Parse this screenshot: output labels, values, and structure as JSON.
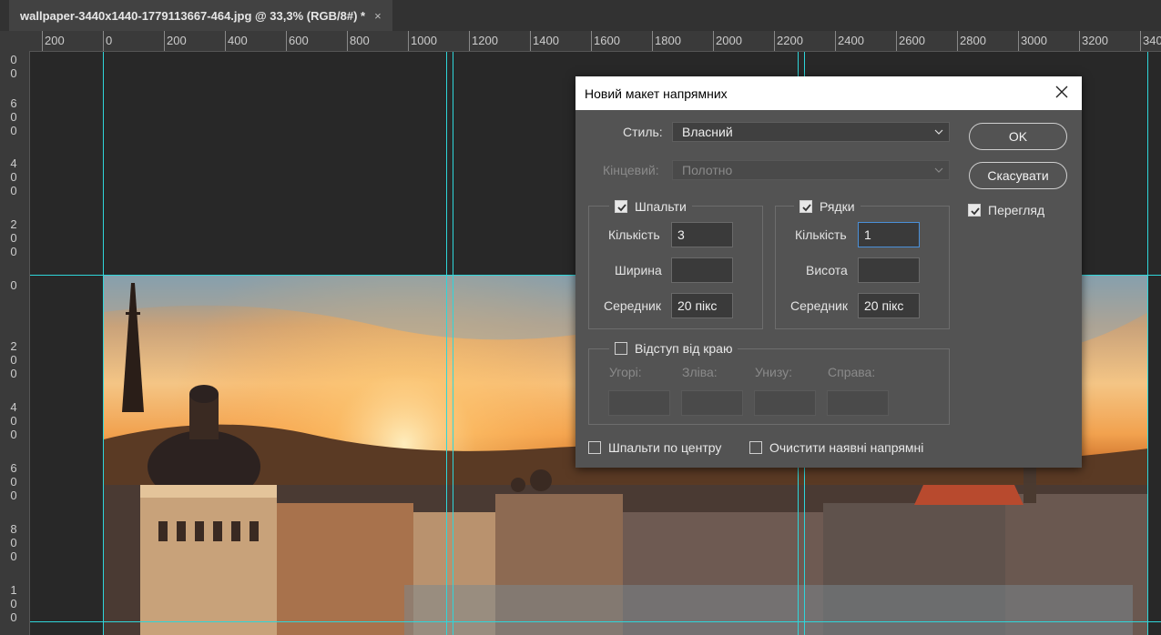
{
  "tab": {
    "title": "wallpaper-3440x1440-1779113667-464.jpg @ 33,3% (RGB/8#) *",
    "close": "×"
  },
  "ruler_h": [
    "200",
    "0",
    "200",
    "400",
    "600",
    "800",
    "1000",
    "1200",
    "1400",
    "1600",
    "1800",
    "2000",
    "2200",
    "2400",
    "2600",
    "2800",
    "3000",
    "3200",
    "340"
  ],
  "ruler_v": [
    [
      "0",
      "0"
    ],
    [
      "6",
      "0",
      "0"
    ],
    [
      "4",
      "0",
      "0"
    ],
    [
      "2",
      "0",
      "0"
    ],
    [
      "0"
    ],
    [
      "2",
      "0",
      "0"
    ],
    [
      "4",
      "0",
      "0"
    ],
    [
      "6",
      "0",
      "0"
    ],
    [
      "8",
      "0",
      "0"
    ],
    [
      "1",
      "0",
      "0"
    ]
  ],
  "dialog": {
    "title": "Новий макет напрямних",
    "style_label": "Стиль:",
    "style_value": "Власний",
    "target_label": "Кінцевий:",
    "target_value": "Полотно",
    "ok": "OK",
    "cancel": "Скасувати",
    "preview_label": "Перегляд",
    "preview_checked": true,
    "columns": {
      "label": "Шпальти",
      "checked": true,
      "number_label": "Кількість",
      "number_value": "3",
      "width_label": "Ширина",
      "width_value": "",
      "gutter_label": "Середник",
      "gutter_value": "20 пікс"
    },
    "rows": {
      "label": "Рядки",
      "checked": true,
      "number_label": "Кількість",
      "number_value": "1",
      "height_label": "Висота",
      "height_value": "",
      "gutter_label": "Середник",
      "gutter_value": "20 пікс"
    },
    "margin": {
      "label": "Відступ від краю",
      "checked": false,
      "top": "Угорі:",
      "left": "Зліва:",
      "bottom": "Унизу:",
      "right": "Справа:"
    },
    "center_columns": "Шпальти по центру",
    "clear_guides": "Очистити наявні напрямні"
  },
  "colors": {
    "guide": "#2fd6da",
    "focus": "#4a90d9",
    "dialog_bg": "#535353"
  }
}
